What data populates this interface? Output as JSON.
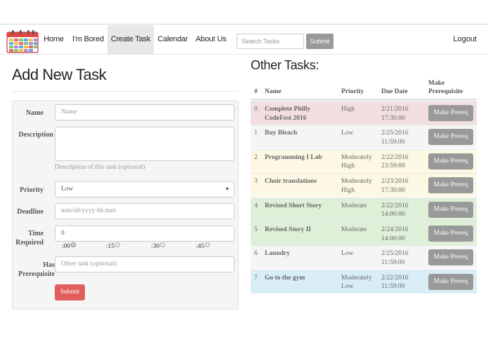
{
  "nav": {
    "items": [
      {
        "label": "Home"
      },
      {
        "label": "I'm Bored"
      },
      {
        "label": "Create Task"
      },
      {
        "label": "Calendar"
      },
      {
        "label": "About Us"
      }
    ],
    "search_placeholder": "Search Tasks",
    "search_button": "Submit",
    "logout": "Logout",
    "logo_icon": "calendar-icon"
  },
  "form": {
    "title": "Add New Task",
    "name_label": "Name",
    "name_placeholder": "Name",
    "description_label": "Description",
    "description_help": "Description of this task (optional)",
    "priority_label": "Priority",
    "priority_value": "Low",
    "deadline_label": "Deadline",
    "deadline_placeholder": "mm/dd/yyyy hh:mm",
    "time_label": "Time Required",
    "time_value": "0",
    "minute_options": [
      ":00",
      ":15",
      ":30",
      ":45"
    ],
    "minute_selected": ":00",
    "prereq_label": "Has Prerequisite",
    "prereq_placeholder": "Other task (optional)",
    "submit": "Submit"
  },
  "tasks": {
    "title": "Other Tasks:",
    "headers": {
      "num": "#",
      "name": "Name",
      "priority": "Priority",
      "due": "Due Date",
      "prereq": "Make Prerequisite"
    },
    "rows": [
      {
        "num": "0",
        "name": "Complete Philly CodeFest 2016",
        "priority": "High",
        "due": "2/21/2016 17:30:00",
        "button": "Make Prereq",
        "color": "#f2dede"
      },
      {
        "num": "1",
        "name": "Buy Bleach",
        "priority": "Low",
        "due": "2/25/2016 11:59:00",
        "button": "Make Prereq",
        "color": "#f5f5f5"
      },
      {
        "num": "2",
        "name": "Programming I Lab",
        "priority": "Moderately High",
        "due": "2/22/2016 23:59:00",
        "button": "Make Prereq",
        "color": "#fcf8e3"
      },
      {
        "num": "3",
        "name": "Choir translations",
        "priority": "Moderately High",
        "due": "2/23/2016 17:30:00",
        "button": "Make Prereq",
        "color": "#fcf8e3"
      },
      {
        "num": "4",
        "name": "Revised Short Story",
        "priority": "Moderate",
        "due": "2/22/2016 14:00:00",
        "button": "Make Prereq",
        "color": "#dff0d8"
      },
      {
        "num": "5",
        "name": "Revised Story II",
        "priority": "Moderate",
        "due": "2/24/2016 14:00:00",
        "button": "Make Prereq",
        "color": "#dff0d8"
      },
      {
        "num": "6",
        "name": "Laundry",
        "priority": "Low",
        "due": "2/25/2016 11:59:00",
        "button": "Make Prereq",
        "color": "#f5f5f5"
      },
      {
        "num": "7",
        "name": "Go to the gym",
        "priority": "Moderately Low",
        "due": "2/22/2016 11:59:00",
        "button": "Make Prereq",
        "color": "#d9edf7"
      }
    ]
  },
  "colors": {
    "accent": "#e05d5b",
    "button_gray": "#999999"
  }
}
